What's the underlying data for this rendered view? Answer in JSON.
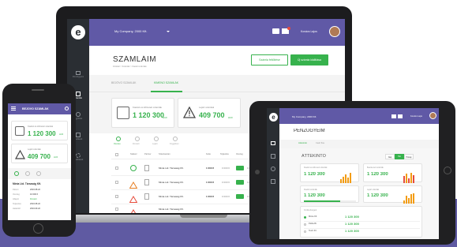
{
  "colors": {
    "accent": "#6059a6",
    "green": "#37b24d",
    "warning": "#f39c12",
    "danger": "#e74c3c",
    "dark": "#2a2e33"
  },
  "laptop": {
    "logo": "e",
    "company": "My Company, 2000 Kft.",
    "user": "Kovács Lajos",
    "title": "SZÁMLÁIM",
    "breadcrumb": "Főoldal > Számlák > Kiadott számlák",
    "btn_outline": "Számla feltöltése",
    "btn_green": "Új számla kiállítása",
    "tabs": [
      "BEJÖVŐ SZÁMLÁK",
      "KIMENŐ SZÁMLÁK"
    ],
    "sidebar": [
      "Pénzügyeim",
      "Számlák",
      "Ügyfelek",
      "Kiadások",
      "Beállítások"
    ],
    "card1": {
      "label": "Kiadott és kifizetett számlák",
      "value": "1 120 300",
      "unit": "HUF"
    },
    "card2": {
      "label": "Lejárt számlák",
      "value": "409 700",
      "unit": "HUF"
    },
    "filters": [
      "Összes",
      "Fizetett",
      "Lejárt",
      "Függőben"
    ],
    "columns": [
      "Státusz",
      "Partner",
      "Számlaszám",
      "Kelte",
      "Teljesítés",
      "Összeg",
      "Határidő"
    ],
    "rows": [
      {
        "name": "Minta Ltd. Társaság Kft.",
        "a": "1 000 ft",
        "b": "0 000 ft"
      },
      {
        "name": "Minta Ltd. Társaság Kft.",
        "a": "1 000 ft",
        "b": "0 000 ft"
      },
      {
        "name": "Minta Ltd. Társaság Kft.",
        "a": "1 000 ft",
        "b": "0 000 ft"
      },
      {
        "name": "Minta Ltd. Társaság Kft.",
        "a": "1 000 ft",
        "b": "0 000 ft"
      }
    ]
  },
  "phone": {
    "title": "BEJÖVŐ SZÁMLÁK",
    "card1": {
      "label": "Kiadott és kifizetett számlák",
      "value": "1 120 300",
      "unit": "HUF"
    },
    "card2": {
      "label": "Lejárt számlák",
      "value": "409 700",
      "unit": "HUF"
    },
    "partner": "Minta Ltd. Társaság Kft.",
    "fields": [
      [
        "Dátum",
        "2016.08.22"
      ],
      [
        "Összeg",
        "10 000 ft"
      ],
      [
        "Állapot",
        "Fizetett"
      ],
      [
        "Teljesítés",
        "2016.08.22"
      ],
      [
        "Határidő",
        "2016.09.22"
      ]
    ]
  },
  "tablet": {
    "company": "My Company, 2000 Kft.",
    "title": "PÉNZÜGYEIM",
    "tabs": [
      "Áttekintés",
      "Cash flow"
    ],
    "section": "ÁTTEKINTŐ",
    "period_buttons": [
      "Nap",
      "Hét",
      "Hónap"
    ],
    "kpi1": {
      "label": "Kiadott és kifizetett számlák",
      "value": "1 120 300",
      "unit": "HUF"
    },
    "kpi2": {
      "label": "Beérkezett számlák",
      "value": "1 120 300",
      "unit": "HUF"
    },
    "kpi3": {
      "label": "Kiadott számlák",
      "value": "1 120 300",
      "unit": "HUF"
    },
    "kpi4": {
      "label": "Lejárt számlák",
      "value": "1 120 300",
      "unit": "HUF"
    },
    "list_title": "Kintlévőségek",
    "list_rows": [
      {
        "label": "Minta Kft.",
        "value": "1 120 300"
      },
      {
        "label": "Példa Bt.",
        "value": "1 120 300"
      },
      {
        "label": "Teszt Zrt.",
        "value": "1 120 300"
      }
    ]
  }
}
